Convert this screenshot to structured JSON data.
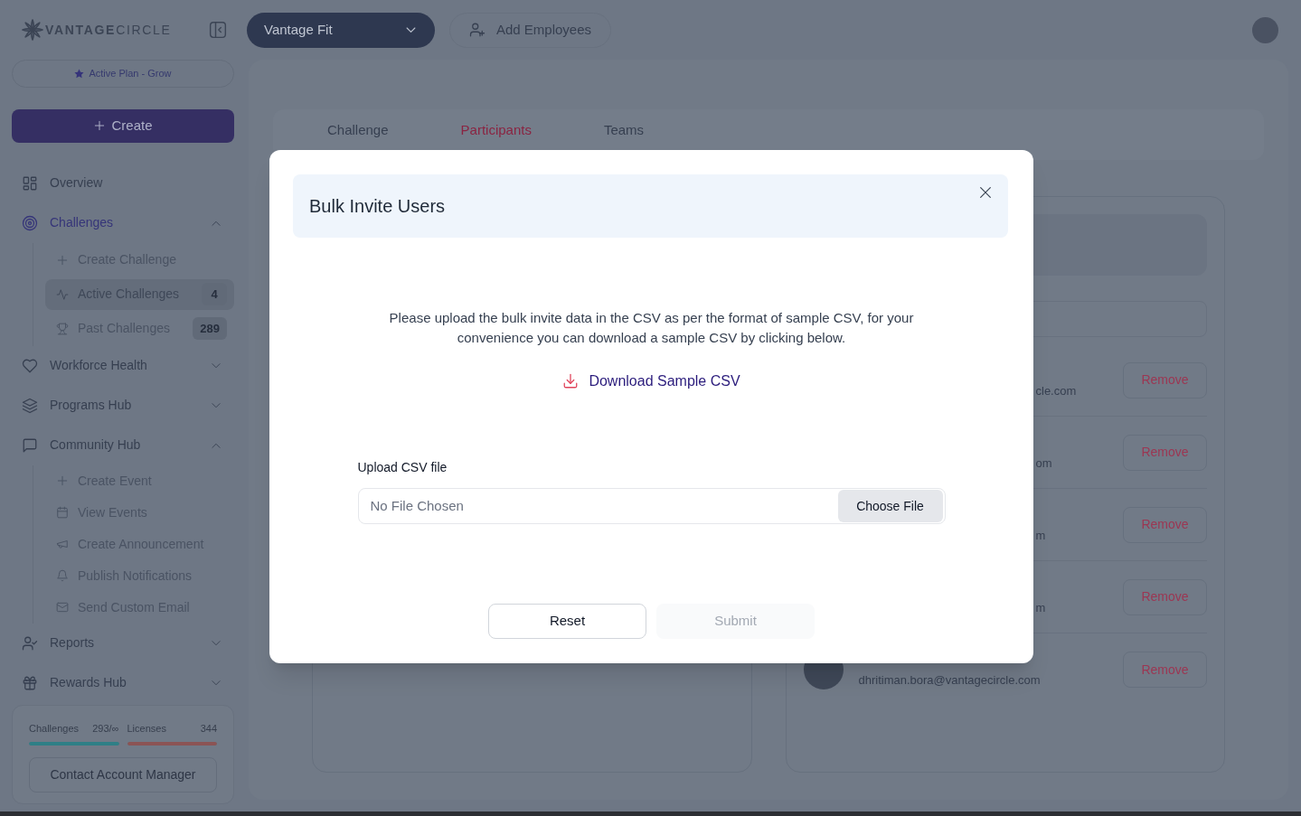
{
  "header": {
    "logo": "**VANTAGE**CIRCLE",
    "product_switcher": {
      "value": "Vantage Fit"
    },
    "add_employees": "Add Employees"
  },
  "sidebar": {
    "plan": "Active Plan - Grow",
    "create": "Create",
    "nav": [
      {
        "label": "Overview",
        "selected": false
      },
      {
        "label": "Challenges",
        "selected": true,
        "expanded": true,
        "children": [
          {
            "label": "Create Challenge",
            "selected": false
          },
          {
            "label": "Active Challenges",
            "selected": true,
            "count": "4"
          },
          {
            "label": "Past Challenges",
            "selected": false,
            "count": "289"
          }
        ]
      },
      {
        "label": "Workforce Health",
        "selected": false,
        "expanded": false
      },
      {
        "label": "Programs Hub",
        "selected": false,
        "expanded": false
      },
      {
        "label": "Community Hub",
        "selected": false,
        "expanded": true,
        "children": [
          {
            "label": "Create Event",
            "selected": false
          },
          {
            "label": "View Events",
            "selected": false
          },
          {
            "label": "Create Announcement",
            "selected": false
          },
          {
            "label": "Publish Notifications",
            "selected": false
          },
          {
            "label": "Send Custom Email",
            "selected": false
          }
        ]
      },
      {
        "label": "Reports",
        "selected": false,
        "expanded": false
      },
      {
        "label": "Rewards Hub",
        "selected": false,
        "expanded": false
      }
    ],
    "usage": [
      {
        "label": "Challenges",
        "value": "293/∞",
        "level": 1,
        "color": "#2f7f86"
      },
      {
        "label": "Licenses",
        "value": "344",
        "level": 1,
        "color": "#8b5454"
      }
    ],
    "contact": "Contact Account Manager"
  },
  "main": {
    "tabs": [
      {
        "label": "Challenge",
        "selected": false
      },
      {
        "label": "Participants",
        "selected": true
      },
      {
        "label": "Teams",
        "selected": false
      }
    ],
    "participants": [
      {
        "kind": "clipped",
        "email": "cle.com",
        "action": "Remove"
      },
      {
        "kind": "clipped",
        "email": "om",
        "action": "Remove"
      },
      {
        "kind": "clipped",
        "email": "m",
        "action": "Remove"
      },
      {
        "kind": "clipped",
        "email": "m",
        "action": "Remove"
      },
      {
        "kind": "full",
        "email": "dhritiman.bora@vantagecircle.com",
        "action": "Remove"
      }
    ]
  },
  "modal": {
    "title": "Bulk Invite Users",
    "message": "Please upload the bulk invite data in the CSV as per the format of sample CSV, for your convenience you can download a sample CSV by clicking below.",
    "download": "Download Sample CSV",
    "upload": {
      "label": "Upload CSV file",
      "placeholder": "No File Chosen",
      "button": "Choose File"
    },
    "buttons": [
      {
        "label": "Reset",
        "disabled": false
      },
      {
        "label": "Submit",
        "disabled": true
      }
    ]
  }
}
